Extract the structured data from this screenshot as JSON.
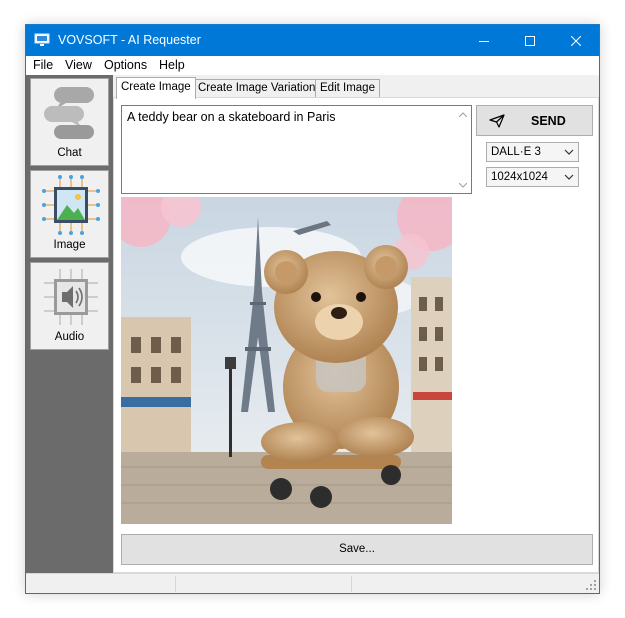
{
  "window": {
    "title": "VOVSOFT - AI Requester"
  },
  "menu": [
    "File",
    "View",
    "Options",
    "Help"
  ],
  "sidebar": {
    "items": [
      {
        "label": "Chat",
        "icon": "chat-bubbles-icon"
      },
      {
        "label": "Image",
        "icon": "image-icon"
      },
      {
        "label": "Audio",
        "icon": "speaker-icon"
      }
    ]
  },
  "tabs": [
    {
      "label": "Create Image",
      "active": true
    },
    {
      "label": "Create Image Variation",
      "active": false
    },
    {
      "label": "Edit Image",
      "active": false
    }
  ],
  "prompt": {
    "value": "A teddy bear on a skateboard in Paris"
  },
  "send": {
    "label": "SEND"
  },
  "model_select": {
    "value": "DALL·E 3"
  },
  "size_select": {
    "value": "1024x1024"
  },
  "save": {
    "label": "Save..."
  },
  "colors": {
    "titlebar": "#0078d7",
    "sidebar": "#6b6b6b"
  }
}
